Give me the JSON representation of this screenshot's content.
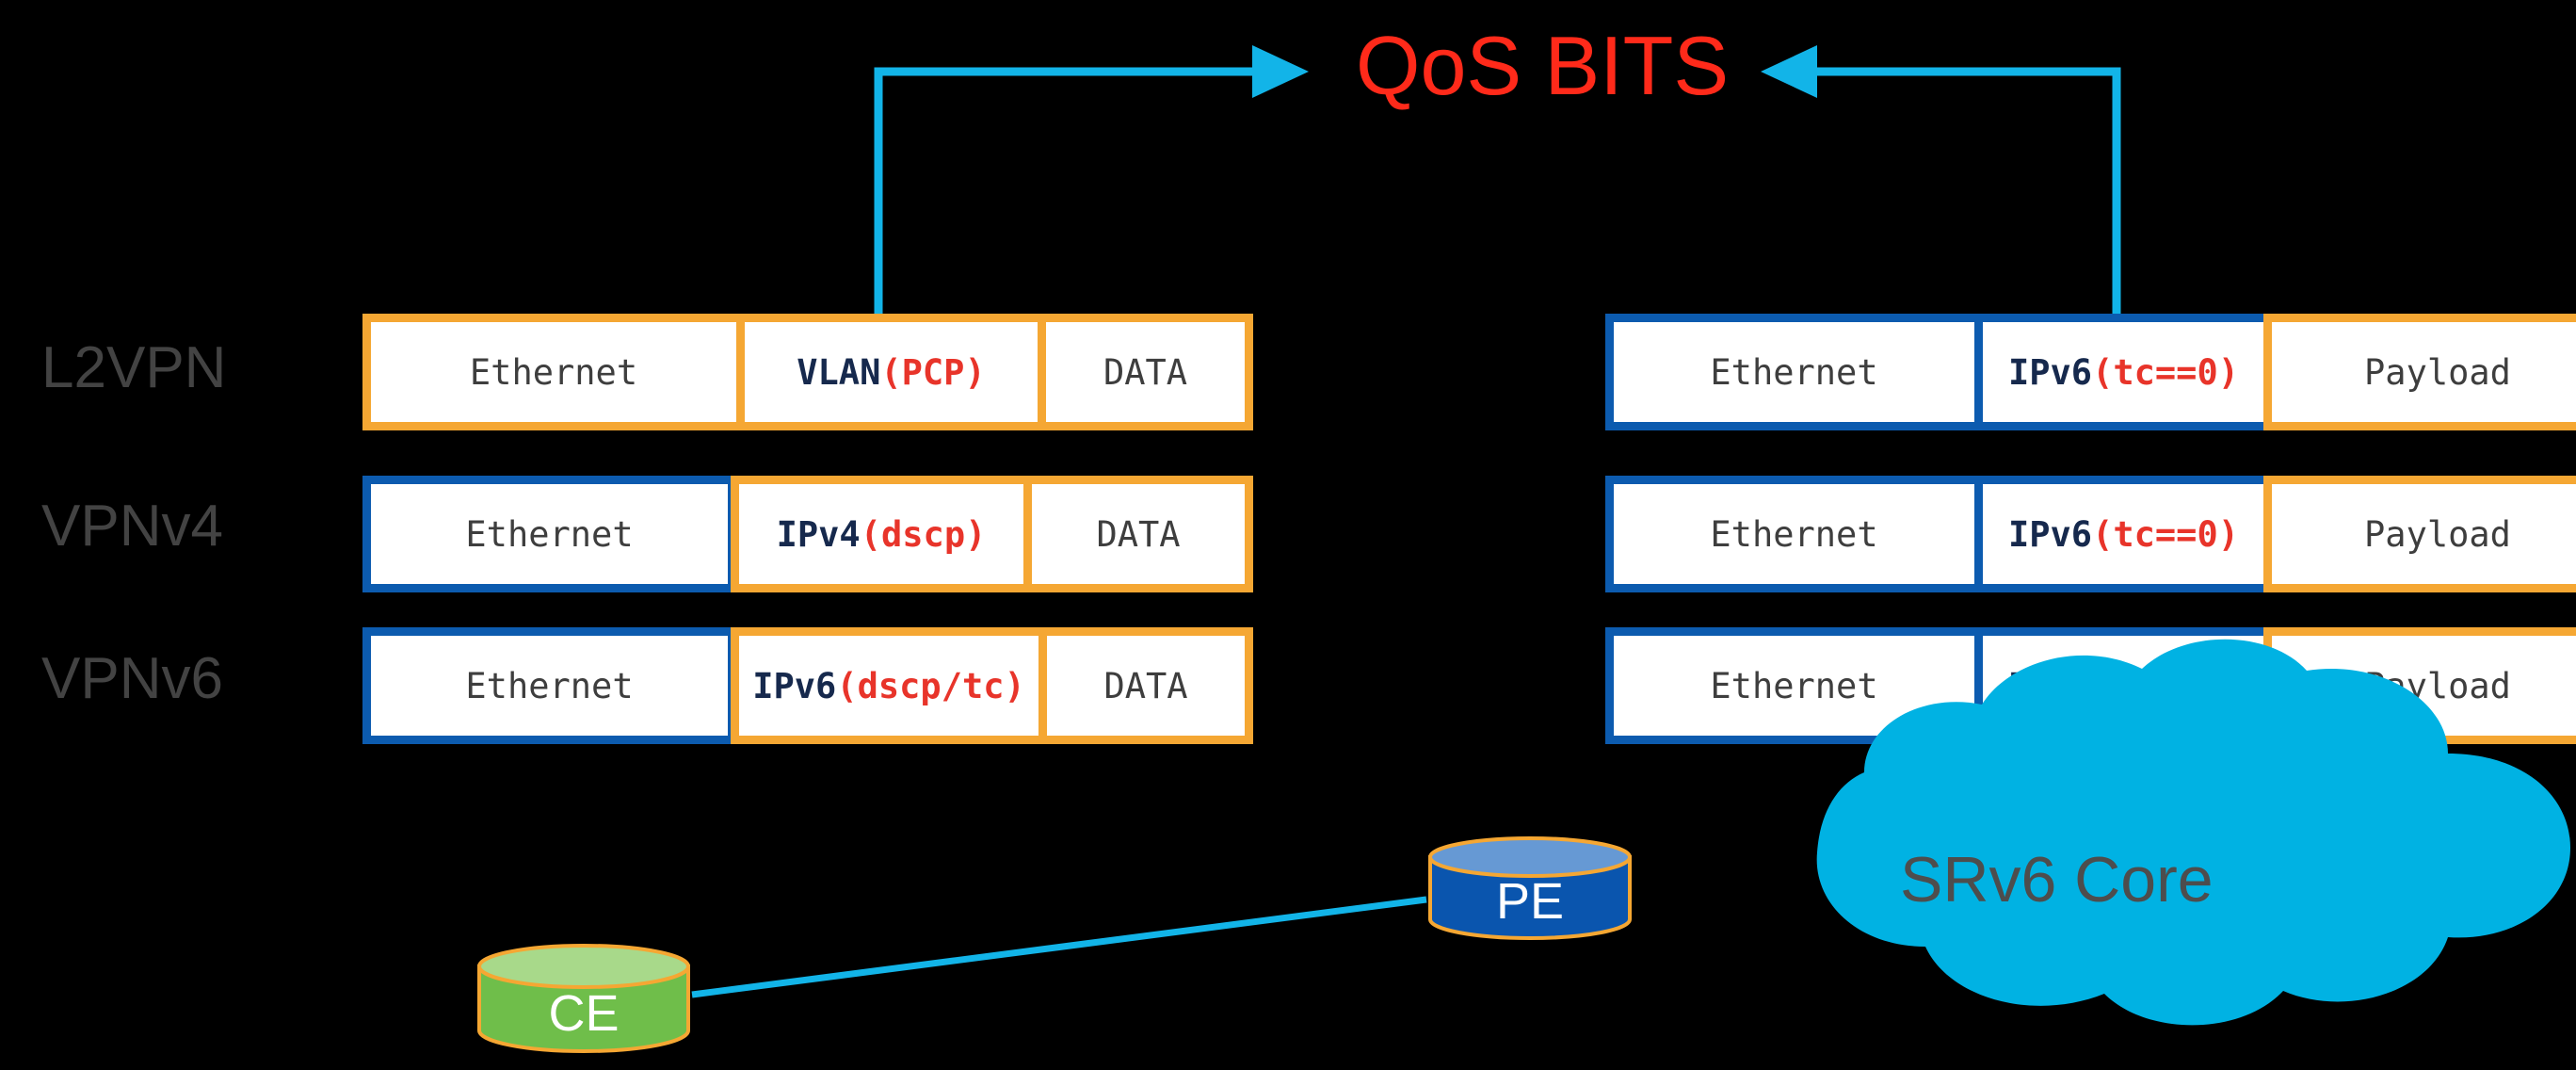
{
  "title": {
    "text": "QoS BITS",
    "color": "#FF2A1A"
  },
  "colors": {
    "background": "#000000",
    "orange_border": "#F5A733",
    "blue_border": "#0C5BAF",
    "cyan_link": "#12B4E8",
    "navy_text": "#16294D",
    "red_text": "#E8342A",
    "gray_text": "#434343",
    "cloud_fill": "#00B2E3",
    "pe_fill": "#0A55AE",
    "pe_top": "#6699D4",
    "ce_fill": "#6FBE4A",
    "ce_top": "#A8D98A"
  },
  "row_labels": [
    {
      "text": "L2VPN"
    },
    {
      "text": "VPNv4"
    },
    {
      "text": "VPNv6"
    }
  ],
  "left_stack": {
    "rows": [
      {
        "name": "l2vpn",
        "border": "orange",
        "cells": [
          {
            "name": "ethernet",
            "text": "Ethernet",
            "style": "mono",
            "border": "orange"
          },
          {
            "name": "vlan-header",
            "text_primary": "VLAN",
            "text_secondary": " (PCP)",
            "style": "hdr",
            "border": "orange"
          },
          {
            "name": "data",
            "text": "DATA",
            "style": "mono",
            "border": "orange"
          }
        ]
      },
      {
        "name": "vpnv4",
        "border": "blue",
        "cells": [
          {
            "name": "ethernet",
            "text": "Ethernet",
            "style": "mono",
            "border": "blue"
          },
          {
            "name": "ipv4-header",
            "text_primary": "IPv4",
            "text_secondary": "(dscp)",
            "style": "hdr",
            "border": "orange"
          },
          {
            "name": "data",
            "text": "DATA",
            "style": "mono",
            "border": "orange"
          }
        ]
      },
      {
        "name": "vpnv6",
        "border": "blue",
        "cells": [
          {
            "name": "ethernet",
            "text": "Ethernet",
            "style": "mono",
            "border": "blue"
          },
          {
            "name": "ipv6-header",
            "text_primary": "IPv6",
            "text_secondary": "(dscp/tc)",
            "style": "hdr",
            "border": "orange"
          },
          {
            "name": "data",
            "text": "DATA",
            "style": "mono",
            "border": "orange"
          }
        ]
      }
    ]
  },
  "right_stack": {
    "rows": [
      {
        "name": "l2vpn-core",
        "border": "blue",
        "cells": [
          {
            "name": "ethernet",
            "text": "Ethernet",
            "style": "mono",
            "border": "blue"
          },
          {
            "name": "ipv6-tc-header",
            "text_primary": "IPv6",
            "text_secondary": "(tc==0)",
            "style": "hdr",
            "border": "blue"
          },
          {
            "name": "payload",
            "text": "Payload",
            "style": "mono",
            "border": "orange"
          }
        ]
      },
      {
        "name": "vpnv4-core",
        "border": "blue",
        "cells": [
          {
            "name": "ethernet",
            "text": "Ethernet",
            "style": "mono",
            "border": "blue"
          },
          {
            "name": "ipv6-tc-header",
            "text_primary": "IPv6",
            "text_secondary": "(tc==0)",
            "style": "hdr",
            "border": "blue"
          },
          {
            "name": "payload",
            "text": "Payload",
            "style": "mono",
            "border": "orange"
          }
        ]
      },
      {
        "name": "vpnv6-core",
        "border": "blue",
        "cells": [
          {
            "name": "ethernet",
            "text": "Ethernet",
            "style": "mono",
            "border": "blue"
          },
          {
            "name": "ipv6-tc-header",
            "text_primary": "IPv6",
            "text_secondary": "(tc==0)",
            "style": "hdr",
            "border": "blue"
          },
          {
            "name": "payload",
            "text": "Payload",
            "style": "mono",
            "border": "orange"
          }
        ]
      }
    ]
  },
  "topology": {
    "cloud": {
      "label": "SRv6 Core"
    },
    "pe": {
      "label": "PE"
    },
    "ce": {
      "label": "CE"
    }
  }
}
